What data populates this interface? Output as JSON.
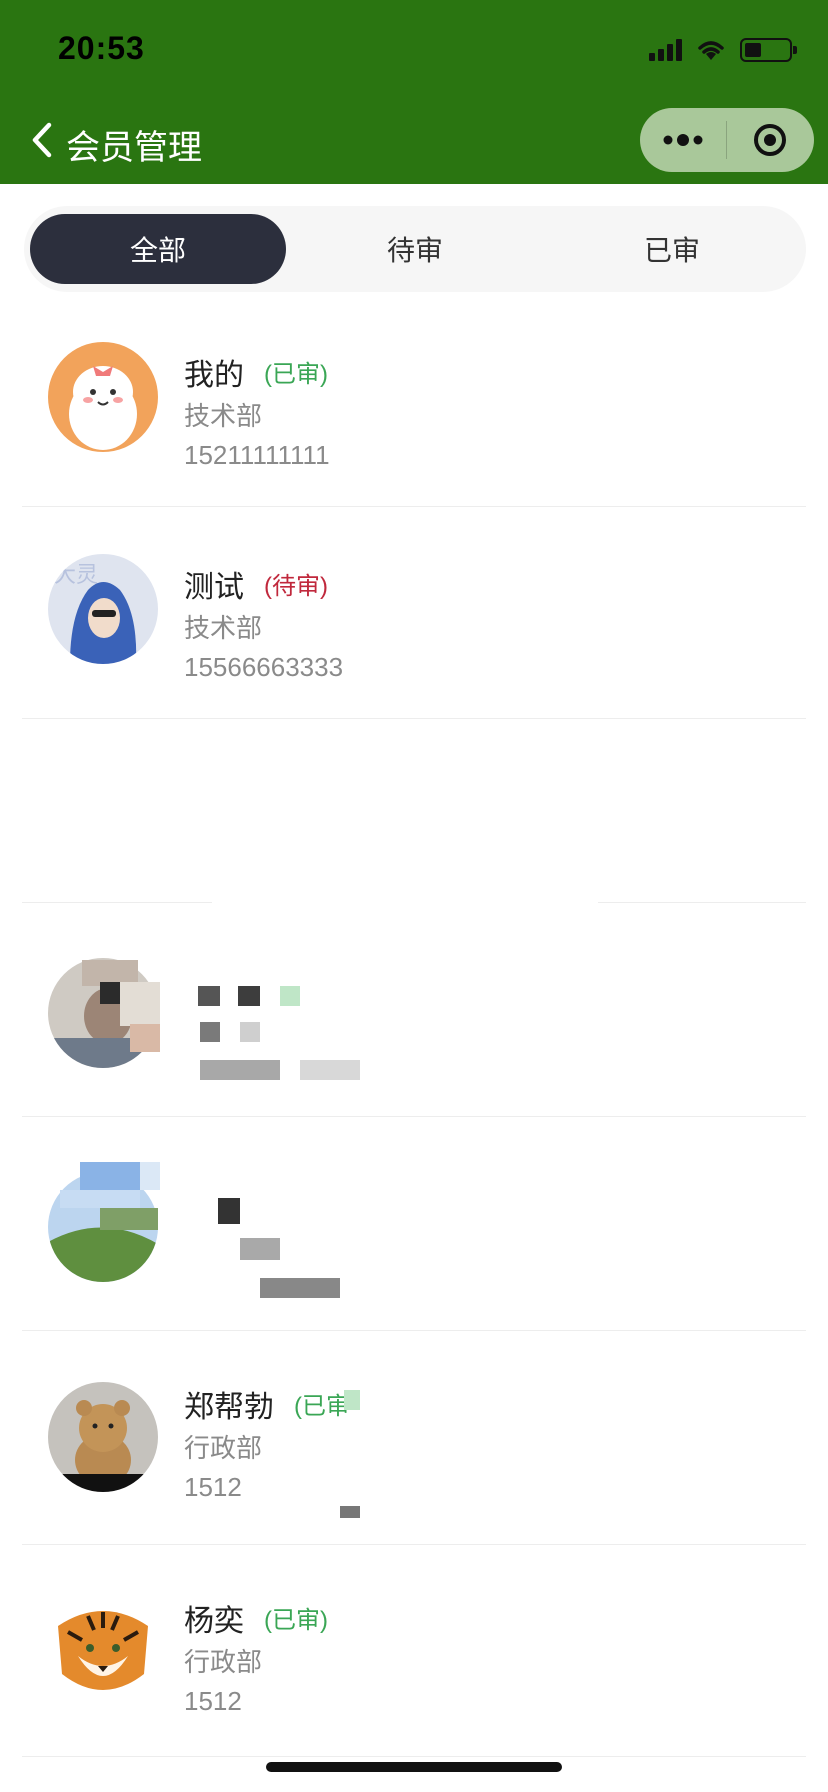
{
  "status_bar": {
    "time": "20:53"
  },
  "nav": {
    "title": "会员管理"
  },
  "tabs": [
    {
      "label": "全部",
      "active": true
    },
    {
      "label": "待审",
      "active": false
    },
    {
      "label": "已审",
      "active": false
    }
  ],
  "members": [
    {
      "name": "我的",
      "status": "(已审)",
      "status_color": "#3aa655",
      "dept": "技术部",
      "phone": "15211111111"
    },
    {
      "name": "测试",
      "status": "(待审)",
      "status_color": "#c0283c",
      "dept": "技术部",
      "phone": "15566663333"
    },
    {
      "name": "",
      "status": "",
      "dept": "",
      "phone": ""
    },
    {
      "name": "",
      "status": "",
      "dept": "",
      "phone": ""
    },
    {
      "name": "",
      "status": "",
      "dept": "",
      "phone": ""
    },
    {
      "name": "郑帮勃",
      "status": "(已审",
      "status_color": "#3aa655",
      "dept": "行政部",
      "phone": "1512"
    },
    {
      "name": "杨奕",
      "status": "(已审)",
      "status_color": "#3aa655",
      "dept": "行政部",
      "phone": "1512"
    }
  ],
  "colors": {
    "header_bg": "#2a7511",
    "tab_active_bg": "#2c2f3d",
    "approved": "#3aa655",
    "pending": "#c0283c"
  }
}
